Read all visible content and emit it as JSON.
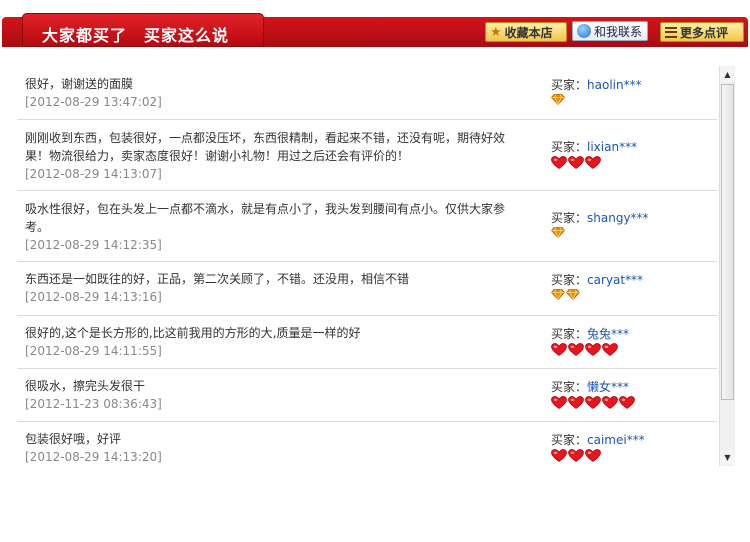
{
  "header": {
    "tab_label": "大家都买了　买家这么说",
    "fav_label": "收藏本店",
    "contact_label": "和我联系",
    "more_label": "更多点评"
  },
  "buyer_prefix": "买家：",
  "reviews": [
    {
      "comment": "很好，谢谢送的面膜",
      "date": "[2012-08-29 13:47:02]",
      "buyer": "haolin***",
      "rank_icon": "diamond",
      "rank_count": 1
    },
    {
      "comment": "刚刚收到东西，包装很好，一点都没压坏，东西很精制，看起来不错，还没有呢，期待好效果！物流很给力，卖家态度很好！谢谢小礼物！用过之后还会有评价的！",
      "date": "[2012-08-29 14:13:07]",
      "buyer": "lixian***",
      "rank_icon": "heart",
      "rank_count": 3
    },
    {
      "comment": "吸水性很好，包在头发上一点都不滴水，就是有点小了，我头发到腰间有点小。仅供大家参考。",
      "date": "[2012-08-29 14:12:35]",
      "buyer": "shangy***",
      "rank_icon": "diamond",
      "rank_count": 1
    },
    {
      "comment": "东西还是一如既往的好，正品，第二次关顾了，不错。还没用，相信不错",
      "date": "[2012-08-29 14:13:16]",
      "buyer": "caryat***",
      "rank_icon": "diamond",
      "rank_count": 2
    },
    {
      "comment": "很好的,这个是长方形的,比这前我用的方形的大,质量是一样的好",
      "date": "[2012-08-29 14:11:55]",
      "buyer": "兔兔***",
      "rank_icon": "heart",
      "rank_count": 4
    },
    {
      "comment": "很吸水，擦完头发很干",
      "date": "[2012-11-23 08:36:43]",
      "buyer": "懒女***",
      "rank_icon": "heart",
      "rank_count": 5
    },
    {
      "comment": "包装很好哦，好评",
      "date": "[2012-08-29 14:13:20]",
      "buyer": "caimei***",
      "rank_icon": "heart",
      "rank_count": 3
    }
  ],
  "colors": {
    "header_red": "#c41018",
    "buyer_link": "#1a56b8",
    "heart_red": "#e8141e",
    "diamond_orange": "#f08c00"
  }
}
